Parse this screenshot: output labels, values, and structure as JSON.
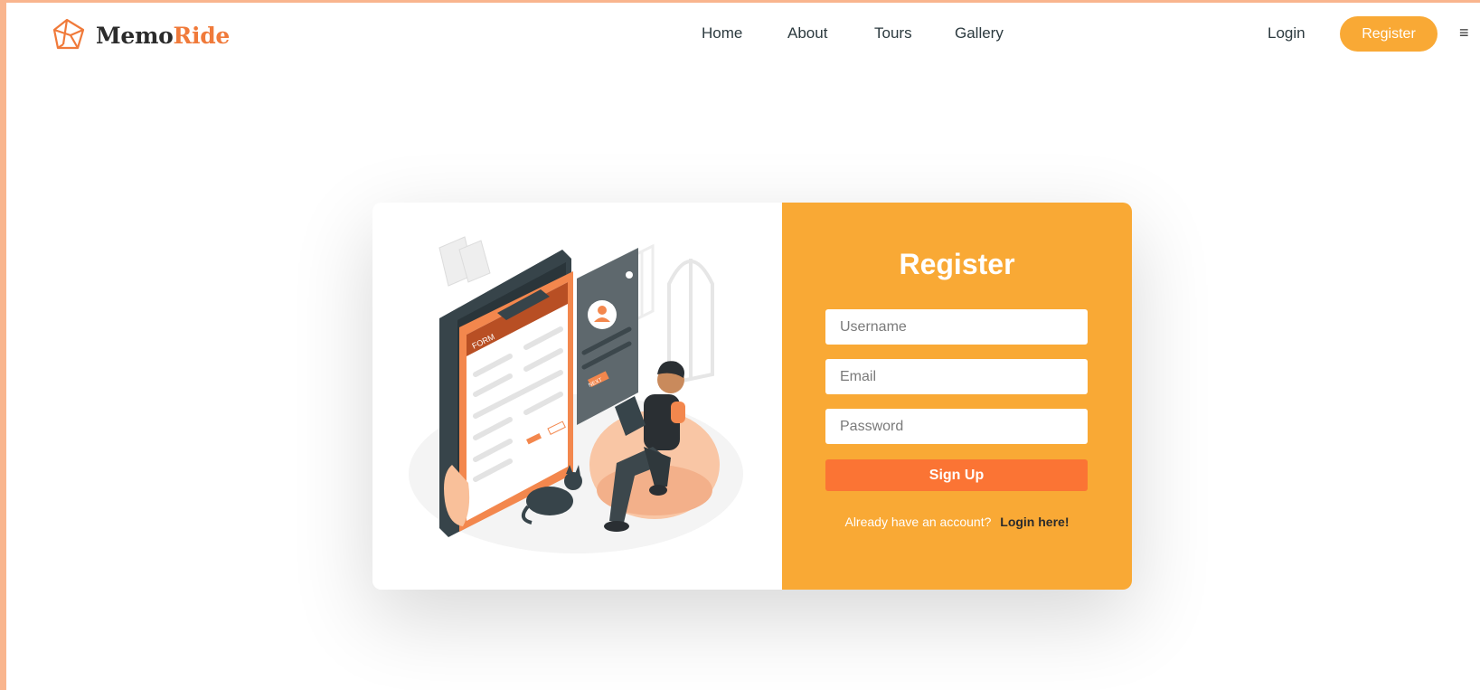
{
  "brand": {
    "part1": "Memo",
    "part2": "Ride"
  },
  "nav": {
    "items": [
      "Home",
      "About",
      "Tours",
      "Gallery"
    ]
  },
  "header": {
    "login_label": "Login",
    "register_label": "Register",
    "menu_icon": "≡"
  },
  "illustration": {
    "form_title": "FORM",
    "next_label": "NEXT"
  },
  "form": {
    "title": "Register",
    "username_placeholder": "Username",
    "email_placeholder": "Email",
    "password_placeholder": "Password",
    "submit_label": "Sign Up",
    "account_question": "Already have an account?",
    "login_link": "Login here!"
  },
  "colors": {
    "accent": "#f9a935",
    "button": "#fb7434",
    "brand": "#f07a3a",
    "frame": "#f9b58e"
  }
}
